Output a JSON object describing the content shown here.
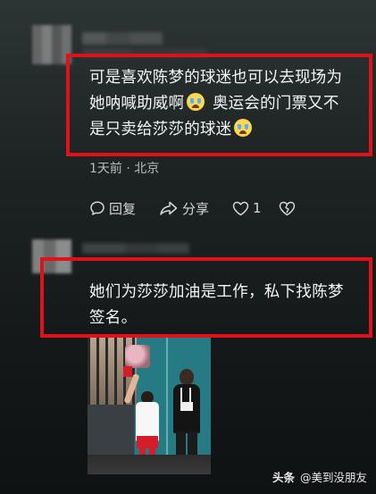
{
  "comments": [
    {
      "text_line1": "可是喜欢陈梦的球迷也可以去现场为",
      "text_line2_a": "她呐喊助威啊",
      "text_line2_b": " 奥运会的门票又不",
      "text_line3": "是只卖给莎莎的球迷",
      "emoji_icon": "crying-face-icon",
      "meta": "1天前 · 北京",
      "actions": {
        "reply_label": "回复",
        "share_label": "分享",
        "like_count": "1"
      }
    },
    {
      "text_line1": "她们为莎莎加油是工作，私下找陈梦",
      "text_line2": "签名。",
      "image_alt": "photo"
    }
  ],
  "watermark": {
    "brand": "头条",
    "handle": "@美到没朋友"
  },
  "colors": {
    "highlight_border": "#e0111a",
    "background": "#1d2323",
    "text": "#f5f5f5",
    "meta_text": "#b8bcbc"
  }
}
